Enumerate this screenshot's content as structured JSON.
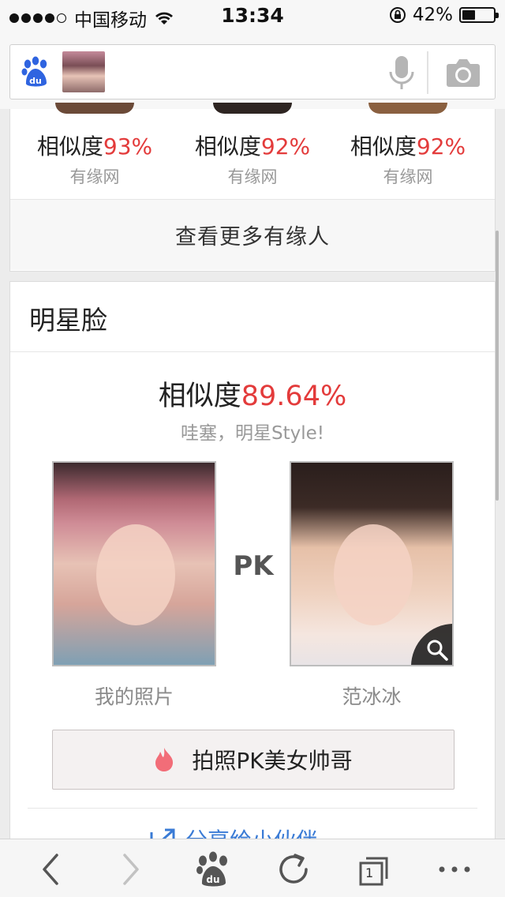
{
  "status_bar": {
    "carrier": "中国移动",
    "time": "13:34",
    "battery_text": "42%",
    "battery_level": 0.42
  },
  "search": {
    "icons": [
      "baidu-paw-icon",
      "microphone-icon",
      "camera-icon"
    ]
  },
  "similar_people": {
    "items": [
      {
        "label": "相似度",
        "percent": "93%",
        "source": "有缘网"
      },
      {
        "label": "相似度",
        "percent": "92%",
        "source": "有缘网"
      },
      {
        "label": "相似度",
        "percent": "92%",
        "source": "有缘网"
      }
    ],
    "more_button": "查看更多有缘人"
  },
  "star_face": {
    "title": "明星脸",
    "similarity_label": "相似度",
    "similarity_value": "89.64%",
    "subtitle": "哇塞，明星Style!",
    "vs_label": "PK",
    "my_photo_caption": "我的照片",
    "star_caption": "范冰冰",
    "action_button": "拍照PK美女帅哥",
    "share_label": "分享给小伙伴"
  },
  "toolbar": {
    "tab_count": "1",
    "icons": [
      "back-icon",
      "forward-icon",
      "baidu-home-icon",
      "refresh-icon",
      "tabs-icon",
      "more-icon"
    ]
  },
  "colors": {
    "accent_red": "#e33b3b",
    "link_blue": "#3a7bd5",
    "flame": "#f26d78"
  }
}
